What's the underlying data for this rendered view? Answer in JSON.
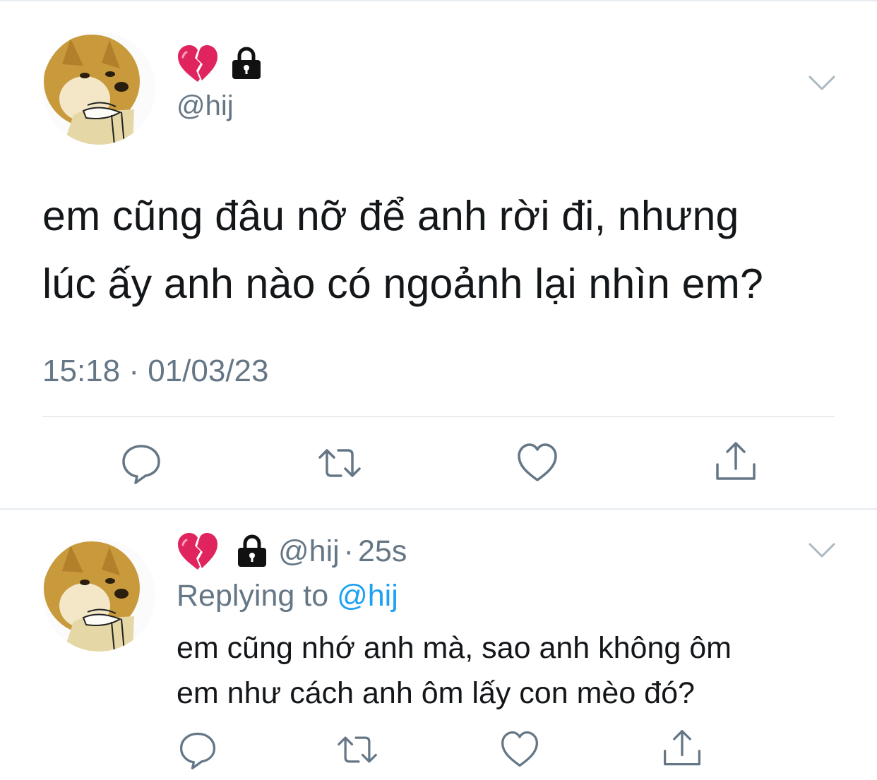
{
  "main_tweet": {
    "author": {
      "emoji": "💔",
      "handle": "@hij",
      "locked": true,
      "avatar": "shiba-dog-avatar"
    },
    "text_line1": "em cũng đâu nỡ để anh rời đi, nhưng",
    "text_line2": "lúc ấy anh nào có ngoảnh lại nhìn em?",
    "timestamp": "15:18 · 01/03/23",
    "actions": [
      "reply-icon",
      "retweet-icon",
      "like-icon",
      "share-icon"
    ]
  },
  "reply_tweet": {
    "author": {
      "emoji": "💔",
      "handle": "@hij",
      "locked": true,
      "avatar": "shiba-dog-avatar"
    },
    "dot": "·",
    "time": "25s",
    "replying_prefix": "Replying to",
    "replying_handle": "@hij",
    "text_line1": "em cũng nhớ anh mà, sao anh không ôm",
    "text_line2": "em như cách anh ôm lấy con mèo đó?",
    "actions": [
      "reply-icon",
      "retweet-icon",
      "like-icon",
      "share-icon"
    ]
  },
  "colors": {
    "text": "#14171a",
    "secondary": "#657786",
    "link": "#1da1f2",
    "divider": "#e6ecf0",
    "heart": "#e0245e"
  }
}
